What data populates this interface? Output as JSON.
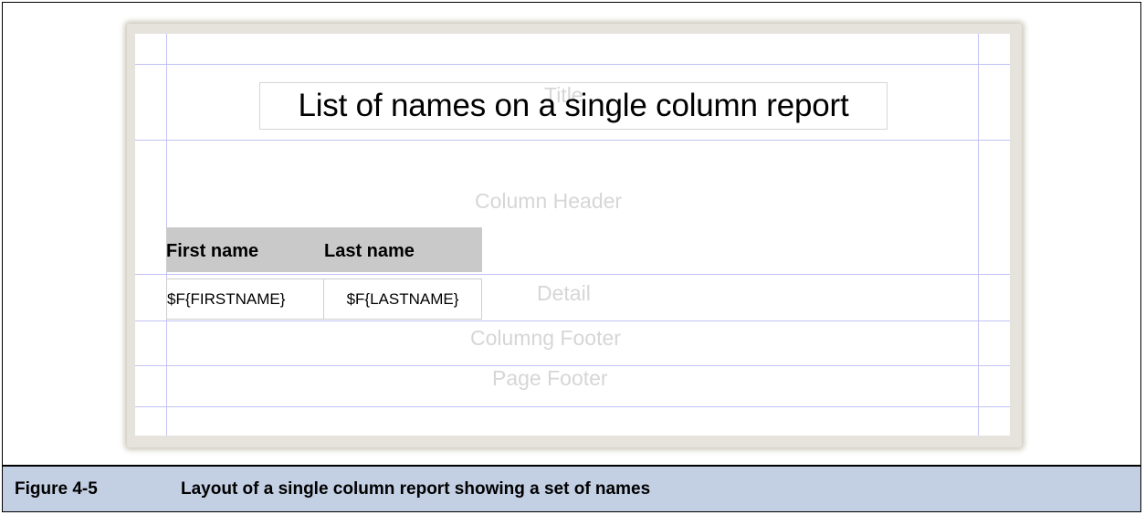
{
  "report": {
    "bands": {
      "title": "Title",
      "column_header": "Column Header",
      "detail": "Detail",
      "column_footer": "Columng Footer",
      "page_footer": "Page Footer"
    },
    "title_text": "List of names on a single column report",
    "column_headers": [
      "First name",
      "Last name"
    ],
    "detail_fields": [
      "$F{FIRSTNAME}",
      "$F{LASTNAME}"
    ]
  },
  "caption": {
    "number": "Figure 4-5",
    "text": "Layout of a single column report showing a set of names"
  },
  "colors": {
    "guide_line": "#c2c2f4",
    "caption_background": "#c3cfe3",
    "header_background": "#c9c9c9"
  }
}
